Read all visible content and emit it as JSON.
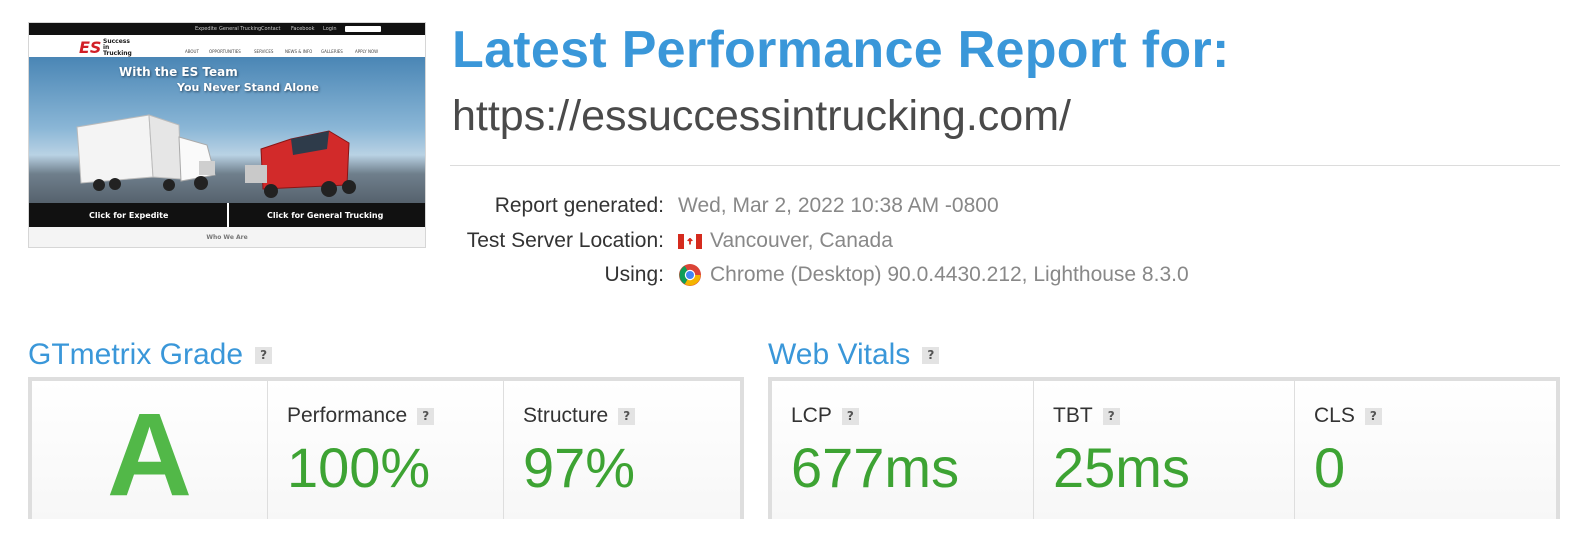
{
  "screenshot": {
    "topbar_items": [
      "Expedite",
      "General Trucking",
      "Contact",
      "Facebook",
      "Login"
    ],
    "logo_mark": "ES",
    "logo_text": "Success in Trucking",
    "nav_items": [
      "ABOUT",
      "OPPORTUNITIES",
      "SERVICES",
      "NEWS & INFO",
      "GALLERIES",
      "APPLY NOW"
    ],
    "hero_line1": "With the ES Team",
    "hero_line2": "You Never Stand Alone",
    "btn_expedite": "Click for Expedite",
    "btn_general": "Click for General Trucking",
    "who_we_are": "Who We Are"
  },
  "header": {
    "title": "Latest Performance Report for:",
    "url": "https://essuccessintrucking.com/"
  },
  "meta": {
    "report_generated_label": "Report generated:",
    "report_generated_value": "Wed, Mar 2, 2022 10:38 AM -0800",
    "location_label": "Test Server Location:",
    "location_value": "Vancouver, Canada",
    "location_flag_icon": "canada-flag-icon",
    "using_label": "Using:",
    "using_value": "Chrome (Desktop) 90.0.4430.212, Lighthouse 8.3.0",
    "using_icon": "chrome-icon"
  },
  "gtmetrix": {
    "title": "GTmetrix Grade",
    "grade": "A",
    "performance_label": "Performance",
    "performance_value": "100%",
    "structure_label": "Structure",
    "structure_value": "97%"
  },
  "web_vitals": {
    "title": "Web Vitals",
    "lcp_label": "LCP",
    "lcp_value": "677ms",
    "tbt_label": "TBT",
    "tbt_value": "25ms",
    "cls_label": "CLS",
    "cls_value": "0"
  },
  "help_glyph": "?",
  "colors": {
    "accent_blue": "#3a97d9",
    "good_green": "#3da333",
    "grade_green": "#52b848"
  }
}
